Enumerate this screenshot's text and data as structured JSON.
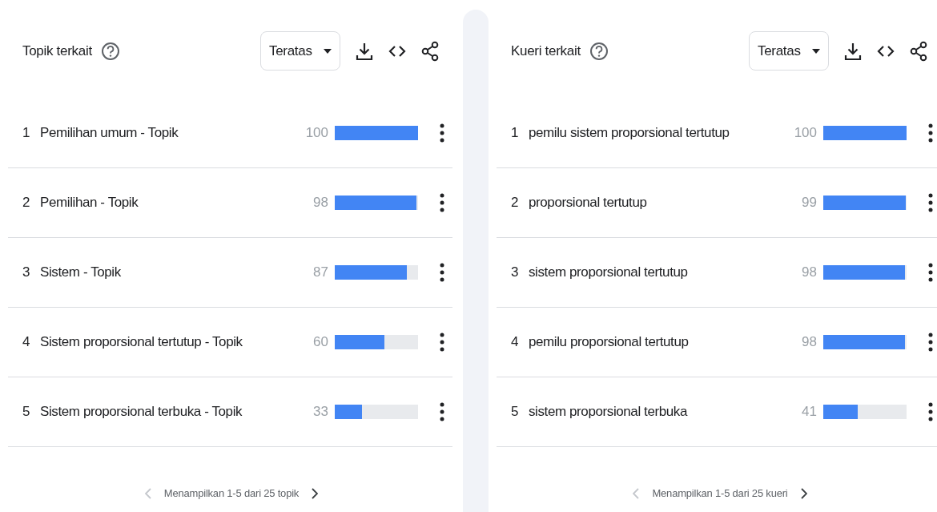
{
  "panels": [
    {
      "title": "Topik terkait",
      "filter": "Teratas",
      "rows": [
        {
          "rank": "1",
          "label": "Pemilihan umum - Topik",
          "value": "100",
          "level": 1.0
        },
        {
          "rank": "2",
          "label": "Pemilihan - Topik",
          "value": "98",
          "level": 0.98
        },
        {
          "rank": "3",
          "label": "Sistem - Topik",
          "value": "87",
          "level": 0.87
        },
        {
          "rank": "4",
          "label": "Sistem proporsional tertutup - Topik",
          "value": "60",
          "level": 0.6
        },
        {
          "rank": "5",
          "label": "Sistem proporsional terbuka - Topik",
          "value": "33",
          "level": 0.33
        }
      ],
      "footer": {
        "text": "Menampilkan 1-5 dari 25 topik",
        "prev_disabled": true,
        "next_disabled": false
      }
    },
    {
      "title": "Kueri terkait",
      "filter": "Teratas",
      "rows": [
        {
          "rank": "1",
          "label": "pemilu sistem proporsional tertutup",
          "value": "100",
          "level": 1.0
        },
        {
          "rank": "2",
          "label": "proporsional tertutup",
          "value": "99",
          "level": 0.99
        },
        {
          "rank": "3",
          "label": "sistem proporsional tertutup",
          "value": "98",
          "level": 0.98
        },
        {
          "rank": "4",
          "label": "pemilu proporsional tertutup",
          "value": "98",
          "level": 0.98
        },
        {
          "rank": "5",
          "label": "sistem proporsional terbuka",
          "value": "41",
          "level": 0.41
        }
      ],
      "footer": {
        "text": "Menampilkan 1-5 dari 25 kueri",
        "prev_disabled": true,
        "next_disabled": false
      }
    }
  ]
}
